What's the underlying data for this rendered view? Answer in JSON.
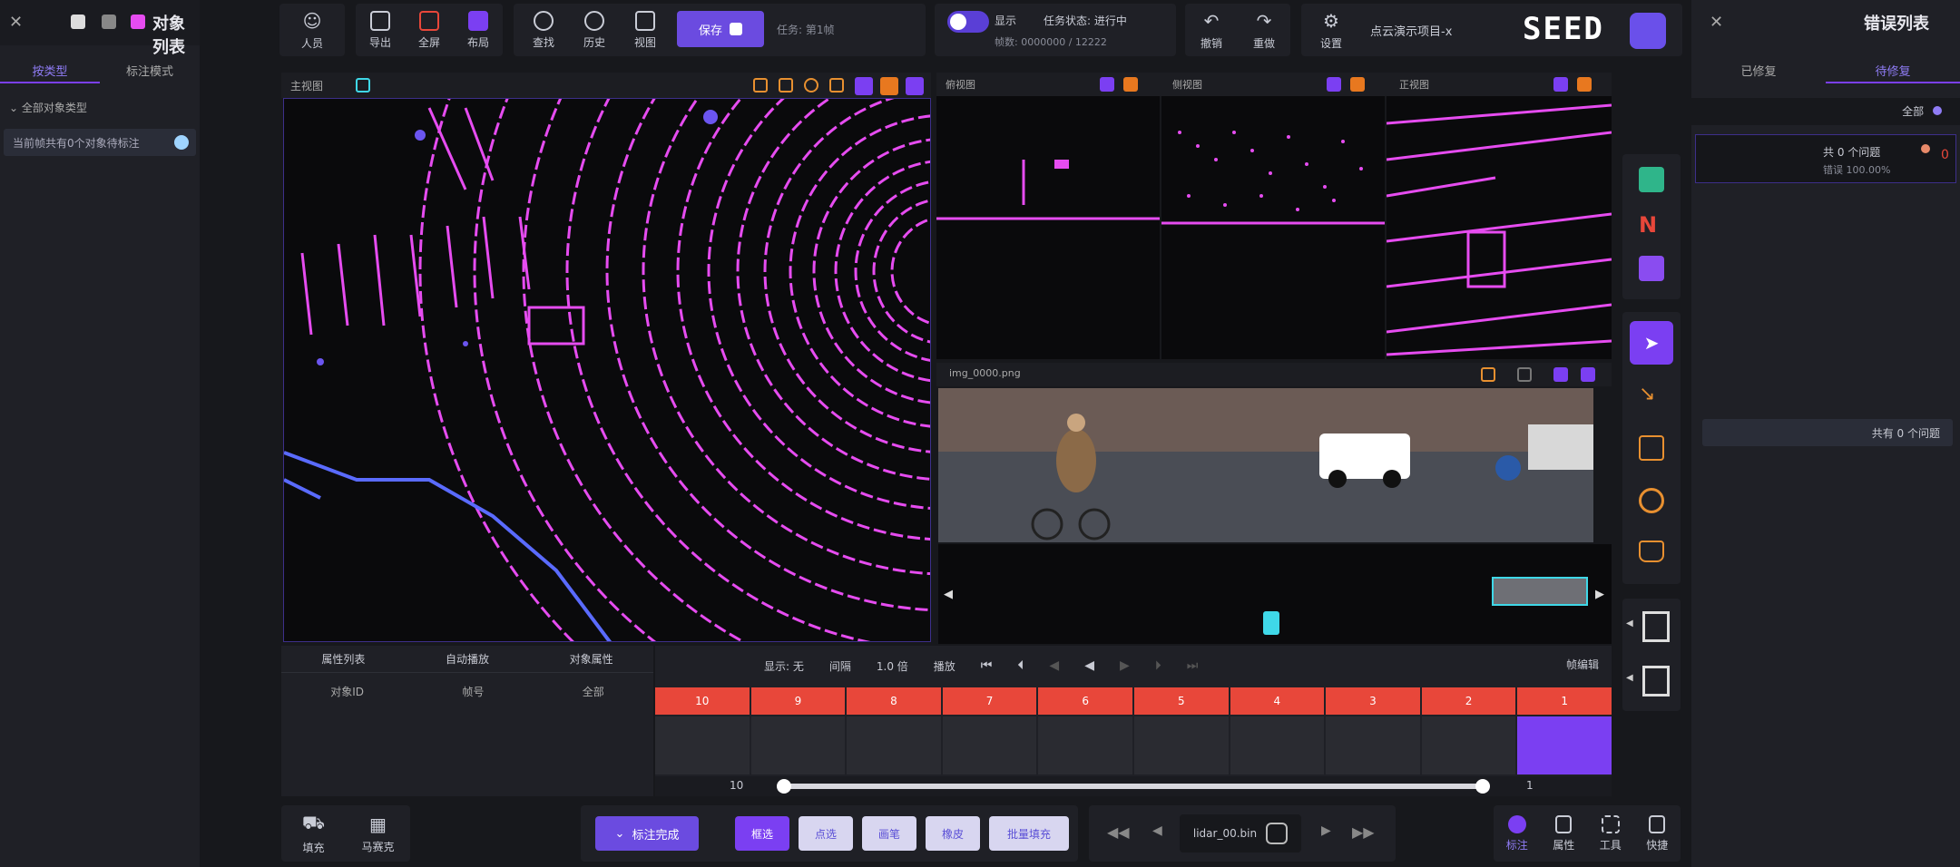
{
  "left_sidebar": {
    "title": "对象列表",
    "tabs": [
      "按类型",
      "标注模式"
    ],
    "filter_label": "全部对象类型",
    "info_text": "当前帧共有0个对象待标注"
  },
  "right_sidebar": {
    "title": "错误列表",
    "tabs": [
      "待修复",
      "已修复"
    ],
    "status": "全部",
    "error_count_text": "共 0 个问题",
    "error_sub_text": "错误 100.00%",
    "list_count_text": "共有 0 个问题"
  },
  "top_toolbar": {
    "tools": [
      {
        "label": "人员",
        "icon": "user-icon"
      },
      {
        "label": "导出",
        "icon": "export-icon"
      },
      {
        "label": "全屏",
        "icon": "fullscreen-icon"
      },
      {
        "label": "布局",
        "icon": "layout-icon"
      },
      {
        "label": "查找",
        "icon": "search-icon"
      },
      {
        "label": "历史",
        "icon": "clock-icon"
      },
      {
        "label": "视图",
        "icon": "monitor-icon"
      }
    ],
    "save_button": "保存",
    "task_text": "任务: 第1帧",
    "toggle_label": "显示",
    "status_title": "任务状态: 进行中",
    "status_sub": "帧数: 0000000 / 12222",
    "undo_label": "撤销",
    "redo_label": "重做",
    "settings_label": "设置",
    "brand": "SEED",
    "brand_sub": "点云演示项目-x"
  },
  "views": {
    "main_label": "主视图",
    "image_label": "img_0000.png",
    "top_label": "俯视图",
    "side_label": "侧视图",
    "front_label": "正视图"
  },
  "right_tools": [
    {
      "name": "cube-tool",
      "label": ""
    },
    {
      "name": "n-tool",
      "label": ""
    },
    {
      "name": "box-tool",
      "label": ""
    },
    {
      "name": "cursor-tool",
      "label": ""
    },
    {
      "name": "polyline-tool",
      "label": ""
    },
    {
      "name": "cube-outline-tool",
      "label": ""
    },
    {
      "name": "sphere-tool",
      "label": ""
    },
    {
      "name": "stamp-tool",
      "label": ""
    }
  ],
  "timeline": {
    "row_labels": [
      "对象属性",
      "自动播放",
      "属性列表"
    ],
    "sub_labels": [
      "全部",
      "帧号",
      "对象ID"
    ],
    "controls": [
      "显示: 无",
      "间隔",
      "1.0 倍",
      "播放"
    ],
    "frame_numbers": [
      "10",
      "9",
      "8",
      "7",
      "6",
      "5",
      "4",
      "3",
      "2",
      "1"
    ],
    "current_frame": "1",
    "range_start": "10",
    "range_end": "1",
    "right_label": "帧编辑"
  },
  "bottom_bar": {
    "left_tools": [
      {
        "label": "填充"
      },
      {
        "label": "马赛克"
      }
    ],
    "dropdown_button": "标注完成",
    "mode_buttons": [
      "框选",
      "点选",
      "画笔",
      "橡皮",
      "批量填充"
    ],
    "file_name": "lidar_00.bin",
    "right_tools": [
      {
        "label": "标注"
      },
      {
        "label": "属性"
      },
      {
        "label": "工具"
      },
      {
        "label": "快捷"
      }
    ]
  },
  "colors": {
    "accent": "#7b3ff2",
    "lidar": "#e64cf0",
    "red": "#e8473a",
    "cyan": "#3fd8e8"
  }
}
